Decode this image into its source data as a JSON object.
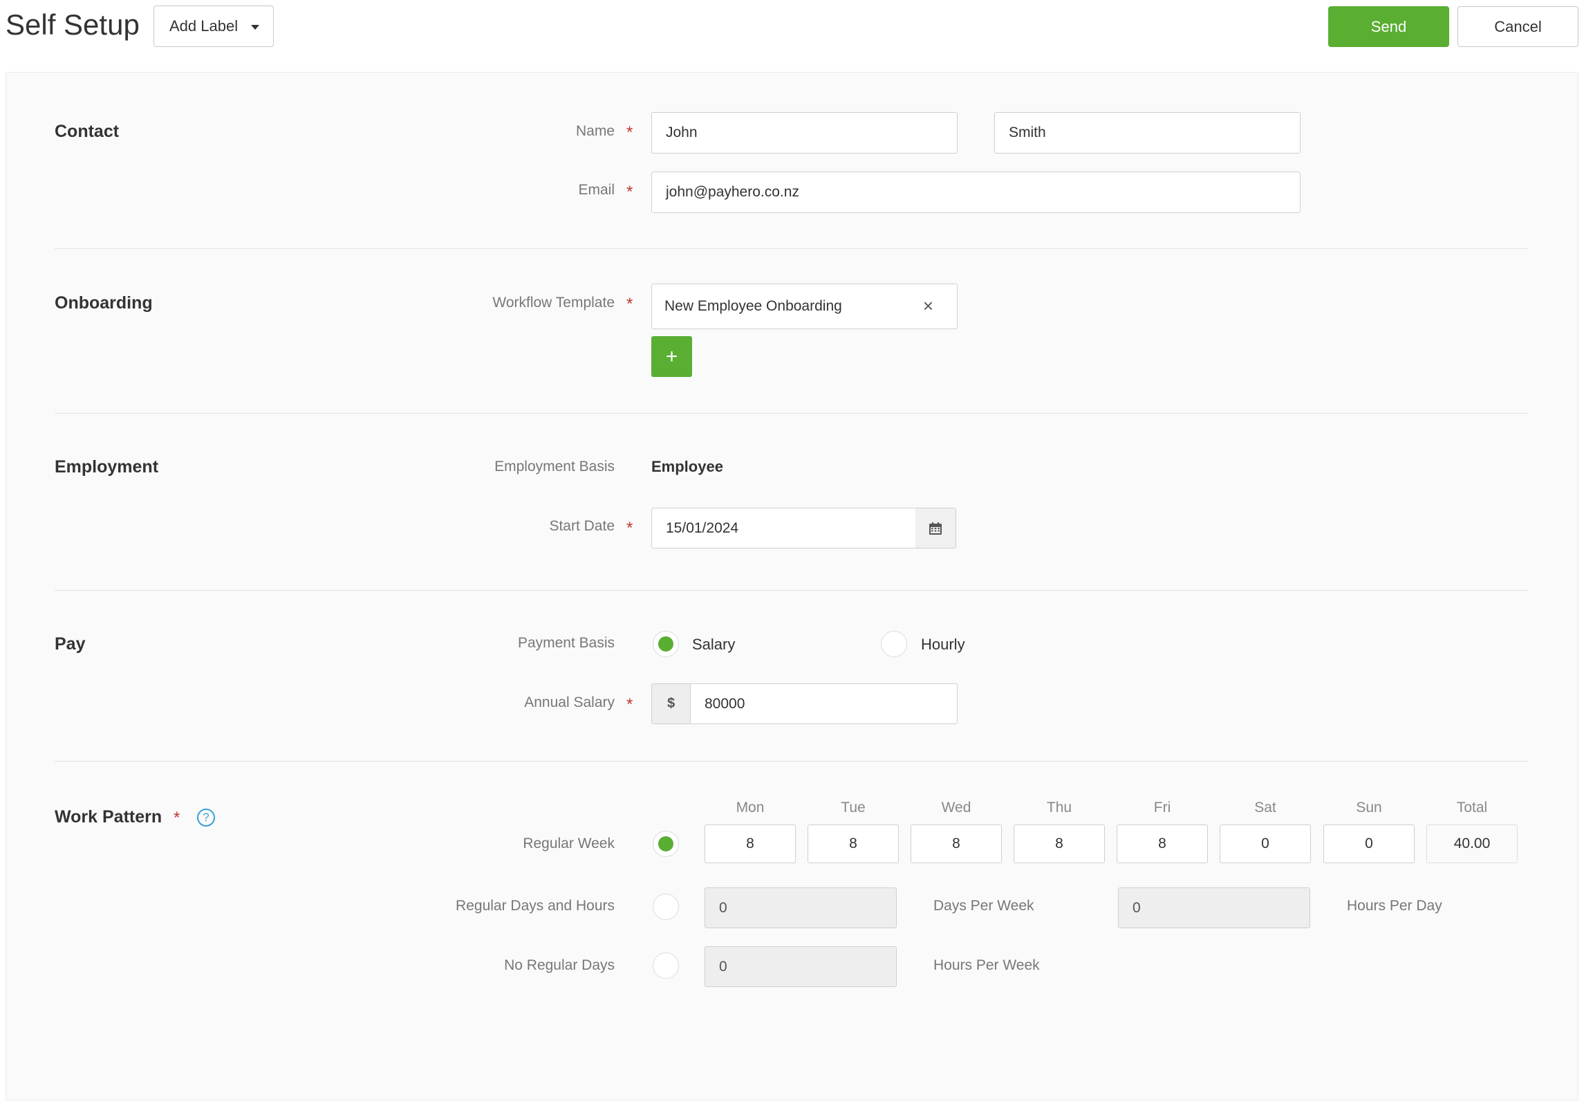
{
  "header": {
    "title": "Self Setup",
    "add_label": "Add Label",
    "send_label": "Send",
    "cancel_label": "Cancel"
  },
  "contact": {
    "section_title": "Contact",
    "name_label": "Name",
    "first_name": "John",
    "last_name": "Smith",
    "email_label": "Email",
    "email": "john@payhero.co.nz"
  },
  "onboarding": {
    "section_title": "Onboarding",
    "workflow_label": "Workflow Template",
    "workflow_value": "New Employee Onboarding",
    "clear_symbol": "×",
    "add_symbol": "+"
  },
  "employment": {
    "section_title": "Employment",
    "basis_label": "Employment Basis",
    "basis_value": "Employee",
    "start_date_label": "Start Date",
    "start_date": "15/01/2024"
  },
  "pay": {
    "section_title": "Pay",
    "basis_label": "Payment Basis",
    "options": [
      "Salary",
      "Hourly"
    ],
    "selected": "Salary",
    "salary_label": "Annual Salary",
    "currency_symbol": "$",
    "salary_value": "80000"
  },
  "work_pattern": {
    "section_title": "Work Pattern",
    "help_symbol": "?",
    "days": [
      "Mon",
      "Tue",
      "Wed",
      "Thu",
      "Fri",
      "Sat",
      "Sun"
    ],
    "total_label": "Total",
    "regular_week_label": "Regular Week",
    "hours": [
      "8",
      "8",
      "8",
      "8",
      "8",
      "0",
      "0"
    ],
    "total": "40.00",
    "regular_days_label": "Regular Days and Hours",
    "days_per_week_value": "0",
    "days_per_week_label": "Days Per Week",
    "hours_per_day_value": "0",
    "hours_per_day_label": "Hours Per Day",
    "no_regular_label": "No Regular Days",
    "hours_per_week_value": "0",
    "hours_per_week_label": "Hours Per Week",
    "selected": "Regular Week"
  },
  "colors": {
    "accent": "#5aae32",
    "required": "#c0392b",
    "help": "#3aa0d8"
  },
  "required_symbol": "*",
  "icons": [
    "caret-down-icon",
    "close-icon",
    "plus-icon",
    "calendar-icon",
    "help-icon",
    "required-asterisk-icon"
  ]
}
